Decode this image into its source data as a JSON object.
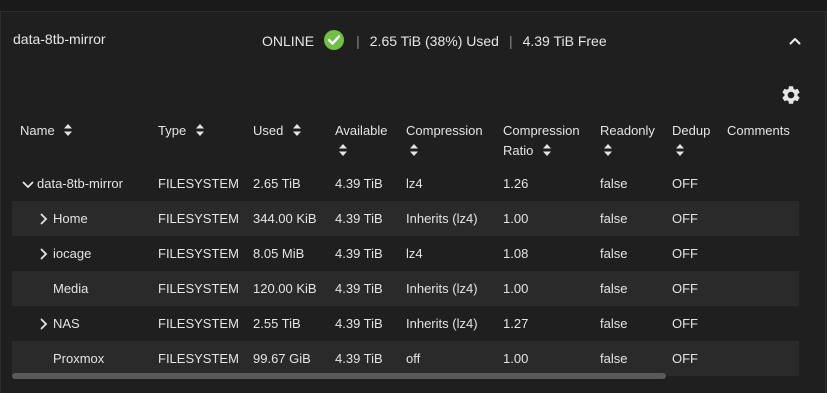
{
  "pool": {
    "name": "data-8tb-mirror",
    "status": "ONLINE",
    "used": "2.65 TiB (38%) Used",
    "free": "4.39 TiB Free",
    "separator": "|"
  },
  "table": {
    "headers": {
      "name": "Name",
      "type": "Type",
      "used": "Used",
      "available": "Available",
      "compression": "Compression",
      "ratio_line1": "Compression",
      "ratio_line2": "Ratio",
      "readonly": "Readonly",
      "dedup": "Dedup",
      "comments": "Comments"
    },
    "rows": [
      {
        "name": "data-8tb-mirror",
        "type": "FILESYSTEM",
        "used": "2.65 TiB",
        "available": "4.39 TiB",
        "compression": "lz4",
        "ratio": "1.26",
        "readonly": "false",
        "dedup": "OFF"
      },
      {
        "name": "Home",
        "type": "FILESYSTEM",
        "used": "344.00 KiB",
        "available": "4.39 TiB",
        "compression": "Inherits (lz4)",
        "ratio": "1.00",
        "readonly": "false",
        "dedup": "OFF"
      },
      {
        "name": "iocage",
        "type": "FILESYSTEM",
        "used": "8.05 MiB",
        "available": "4.39 TiB",
        "compression": "lz4",
        "ratio": "1.08",
        "readonly": "false",
        "dedup": "OFF"
      },
      {
        "name": "Media",
        "type": "FILESYSTEM",
        "used": "120.00 KiB",
        "available": "4.39 TiB",
        "compression": "Inherits (lz4)",
        "ratio": "1.00",
        "readonly": "false",
        "dedup": "OFF"
      },
      {
        "name": "NAS",
        "type": "FILESYSTEM",
        "used": "2.55 TiB",
        "available": "4.39 TiB",
        "compression": "Inherits (lz4)",
        "ratio": "1.27",
        "readonly": "false",
        "dedup": "OFF"
      },
      {
        "name": "Proxmox",
        "type": "FILESYSTEM",
        "used": "99.67 GiB",
        "available": "4.39 TiB",
        "compression": "off",
        "ratio": "1.00",
        "readonly": "false",
        "dedup": "OFF"
      }
    ]
  },
  "colors": {
    "background": "#1f1f1f",
    "alt_row": "#2a2a2a",
    "online_check": "#71bf44",
    "text": "#e4e4e4"
  },
  "icons": {
    "status": "check-circle-icon",
    "collapse": "chevron-up-icon",
    "settings": "gear-icon",
    "sort": "sort-arrows-icon",
    "expand": "chevron-right-icon",
    "expanded": "chevron-down-icon"
  }
}
